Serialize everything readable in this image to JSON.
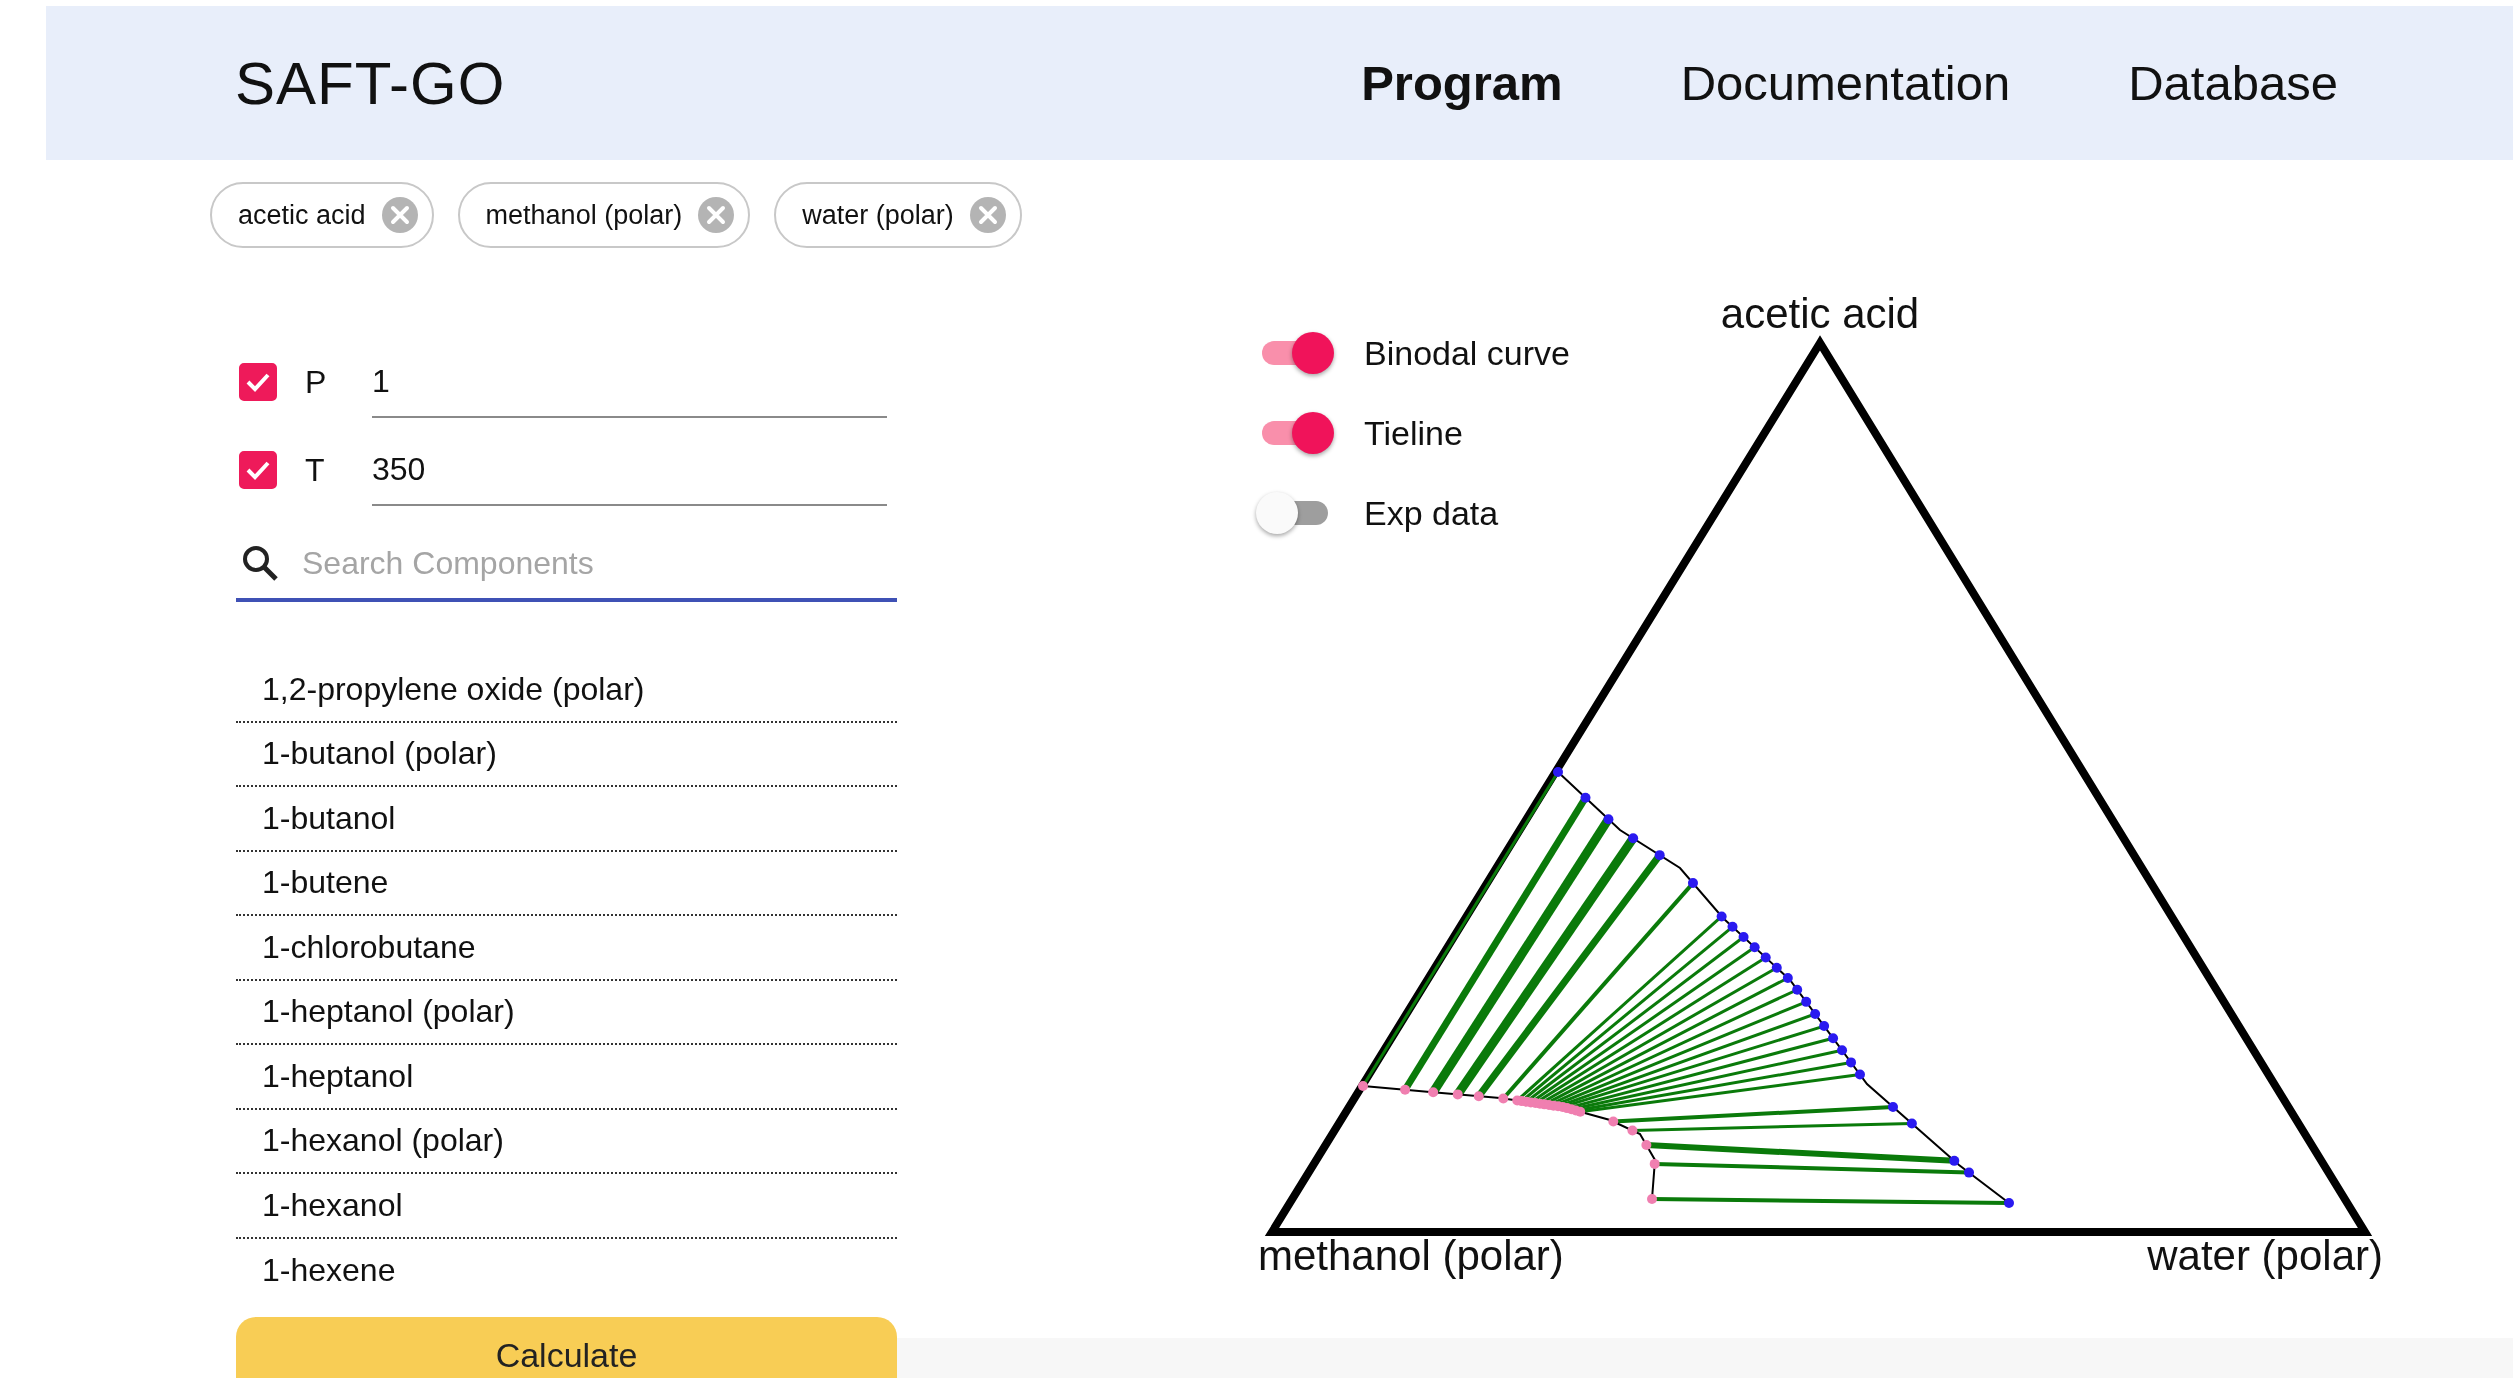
{
  "header": {
    "title": "SAFT-GO",
    "nav": [
      {
        "label": "Program",
        "selected": true
      },
      {
        "label": "Documentation",
        "selected": false
      },
      {
        "label": "Database",
        "selected": false
      }
    ]
  },
  "chips": [
    "acetic acid",
    "methanol (polar)",
    "water (polar)"
  ],
  "conditions": [
    {
      "label": "P",
      "checked": true,
      "value": "1"
    },
    {
      "label": "T",
      "checked": true,
      "value": "350"
    }
  ],
  "search": {
    "placeholder": "Search Components"
  },
  "components": [
    "1,2-propylene oxide (polar)",
    "1-butanol (polar)",
    "1-butanol",
    "1-butene",
    "1-chlorobutane",
    "1-heptanol (polar)",
    "1-heptanol",
    "1-hexanol (polar)",
    "1-hexanol",
    "1-hexene"
  ],
  "calculate_button": "Calculate",
  "plot": {
    "toggles": [
      {
        "label": "Binodal curve",
        "on": true
      },
      {
        "label": "Tieline",
        "on": true
      },
      {
        "label": "Exp data",
        "on": false
      }
    ],
    "vertices": {
      "top": "acetic acid",
      "left": "methanol (polar)",
      "right": "water (polar)"
    }
  }
}
